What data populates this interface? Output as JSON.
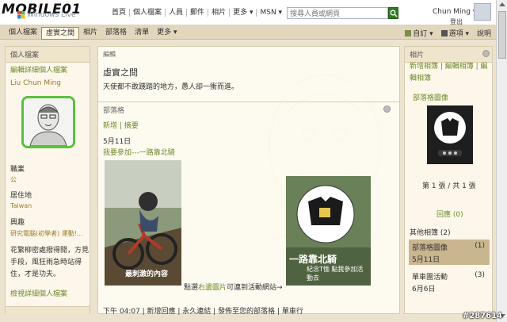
{
  "logo": {
    "brand": "MOBILE01",
    "product": "Windows Live"
  },
  "topnav": [
    "首頁",
    "個人檔案",
    "人員",
    "郵件",
    "相片",
    "更多 ▾",
    "MSN ▾"
  ],
  "search": {
    "placeholder": "搜尋人員或網頁"
  },
  "user": {
    "name": "Chun Ming ▾",
    "signout": "登出"
  },
  "subnav": {
    "items": [
      "個人檔案",
      "虛實之間",
      "相片",
      "部落格",
      "清單",
      "更多 ▾"
    ],
    "active_index": 1
  },
  "subright": {
    "customize": "自訂 ▾",
    "options": "選項 ▾",
    "help": "說明"
  },
  "left": {
    "header": "個人檔案",
    "edit_profile": "編輯詳細個人檔案",
    "name": "Liu Chun Ming",
    "occupation_label": "職業",
    "occupation_value": "公",
    "location_label": "居住地",
    "location_value": "Taiwan",
    "interests_label": "興趣",
    "interests_value": "研究電腦(初學者) 運動!...",
    "quote": "花繁柳密處撥得開，方見手段，風狂雨急時站得住，才是功夫。",
    "more": "檢視詳細個人檔案"
  },
  "mid": {
    "edit": "編輯",
    "space_title": "虛實之間",
    "tagline": "天使都不敢踐踏的地方，愚人卻一衝而進。",
    "blog_header": "部落格",
    "blog_links": "新增 | 摘要",
    "post_date": "5月11日",
    "post_title": "我要參加---一路靠北騎",
    "caption_prefix": "點選",
    "caption_link": "右邊圖片",
    "caption_suffix": "可連到活動網站→",
    "biker_overlay": "最刺激的內容",
    "badge_overlay": "一路靠北騎",
    "badge_sub": "紀念T恤 點我參加活動去",
    "post_footer": "下午 04:07 | 新增回應 | 永久連結 | 發佈至您的部落格 | 單車行"
  },
  "right": {
    "header": "相片",
    "links": "新增相簿 | 編輯相簿 | 編輯相簿",
    "album_title": "部落格圖像",
    "page_count": "第 1 張 / 共 1 張",
    "replies": "回應 (0)",
    "other_albums": "其他相簿 (2)",
    "albums": [
      {
        "name": "部落格圖像",
        "count": "(1)",
        "date": "5月11日"
      },
      {
        "name": "單車團活動",
        "count": "(3)",
        "date": "6月6日"
      }
    ]
  },
  "watermark": "#287614"
}
